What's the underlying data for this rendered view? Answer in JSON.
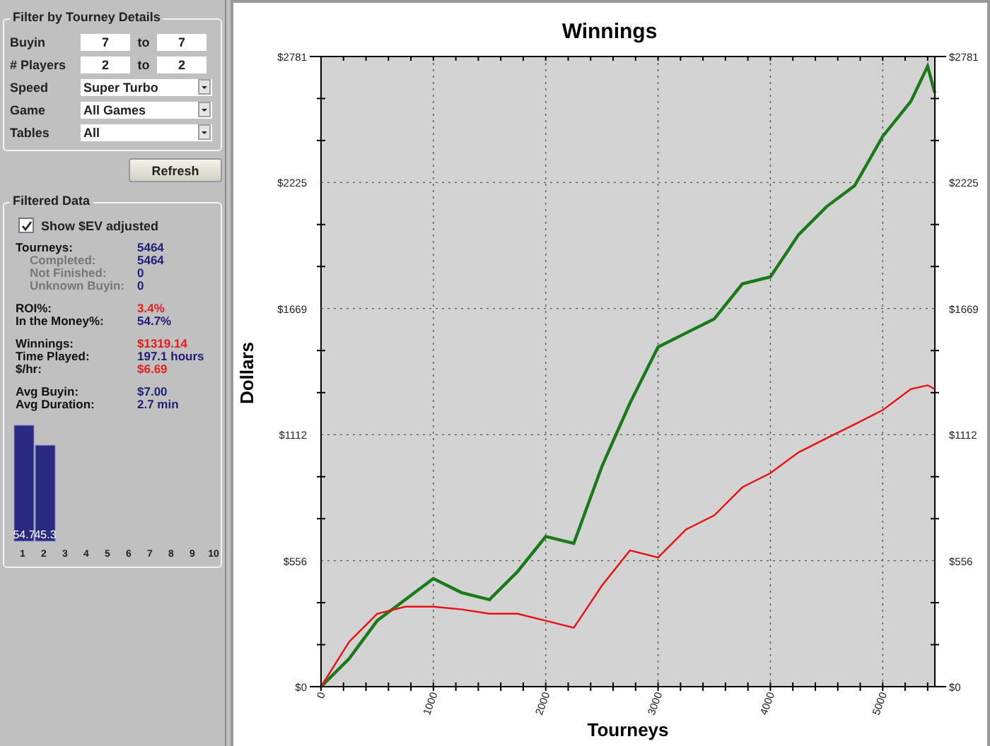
{
  "filter": {
    "title": "Filter by Tourney Details",
    "ranges": [
      {
        "label": "Buyin",
        "from": "7",
        "to_label": "to",
        "to": "7"
      },
      {
        "label": "# Players",
        "from": "2",
        "to_label": "to",
        "to": "2"
      }
    ],
    "dropdowns": [
      {
        "label": "Speed",
        "value": "Super Turbo"
      },
      {
        "label": "Game",
        "value": "All Games"
      },
      {
        "label": "Tables",
        "value": "All"
      }
    ]
  },
  "refresh_button": "Refresh",
  "filtered": {
    "title": "Filtered Data",
    "checkbox": {
      "label": "Show $EV adjusted",
      "checked": true
    },
    "groups": [
      [
        {
          "label": "Tourneys:",
          "value": "5464",
          "color": "#20207a",
          "children": [
            {
              "label": "Completed:",
              "value": "5464",
              "color": "#20207a"
            },
            {
              "label": "Not Finished:",
              "value": "0",
              "color": "#20207a"
            },
            {
              "label": "Unknown Buyin:",
              "value": "0",
              "color": "#20207a"
            }
          ]
        }
      ],
      [
        {
          "label": "ROI%:",
          "value": "3.4%",
          "color": "#e02020"
        },
        {
          "label": "In the Money%:",
          "value": "54.7%",
          "color": "#20207a"
        }
      ],
      [
        {
          "label": "Winnings:",
          "value": "$1319.14",
          "color": "#e02020"
        },
        {
          "label": "Time Played:",
          "value": "197.1 hours",
          "color": "#20207a"
        },
        {
          "label": "$/hr:",
          "value": "$6.69",
          "color": "#e02020"
        }
      ],
      [
        {
          "label": "Avg Buyin:",
          "value": "$7.00",
          "color": "#20207a"
        },
        {
          "label": "Avg Duration:",
          "value": "2.7 min",
          "color": "#20207a"
        }
      ]
    ],
    "histogram": {
      "chart_data": {
        "type": "bar",
        "categories": [
          "1",
          "2",
          "3",
          "4",
          "5",
          "6",
          "7",
          "8",
          "9",
          "10"
        ],
        "values": [
          54.7,
          45.3,
          null,
          null,
          null,
          null,
          null,
          null,
          null,
          null
        ],
        "data_labels": true
      }
    }
  },
  "chart": {
    "chart_data": {
      "type": "line",
      "title": "Winnings",
      "xlabel": "Tourneys",
      "ylabel": "Dollars",
      "x": [
        0,
        250,
        500,
        750,
        1000,
        1250,
        1500,
        1750,
        2000,
        2250,
        2500,
        2750,
        3000,
        3250,
        3500,
        3750,
        4000,
        4250,
        4500,
        4750,
        5000,
        5250,
        5400,
        5464
      ],
      "series": [
        {
          "color": "#1a7a1a",
          "values": [
            0,
            124,
            291,
            384,
            477,
            415,
            384,
            508,
            663,
            632,
            972,
            1251,
            1499,
            1561,
            1623,
            1778,
            1808,
            1994,
            2118,
            2211,
            2428,
            2583,
            2738,
            2620
          ]
        },
        {
          "color": "#e81010",
          "values": [
            0,
            198,
            322,
            353,
            353,
            341,
            322,
            322,
            291,
            260,
            446,
            601,
            570,
            694,
            756,
            880,
            942,
            1034,
            1096,
            1158,
            1220,
            1313,
            1330,
            1313
          ]
        }
      ],
      "xlim": [
        0,
        5464
      ],
      "ylim": [
        0,
        2781
      ],
      "grid": true,
      "xticks": [
        0,
        1000,
        2000,
        3000,
        4000,
        5000
      ],
      "yticks": [
        {
          "value": 0,
          "label": "$0"
        },
        {
          "value": 556,
          "label": "$556"
        },
        {
          "value": 1112,
          "label": "$1112"
        },
        {
          "value": 1669,
          "label": "$1669"
        },
        {
          "value": 2225,
          "label": "$2225"
        },
        {
          "value": 2781,
          "label": "$2781"
        }
      ]
    }
  }
}
